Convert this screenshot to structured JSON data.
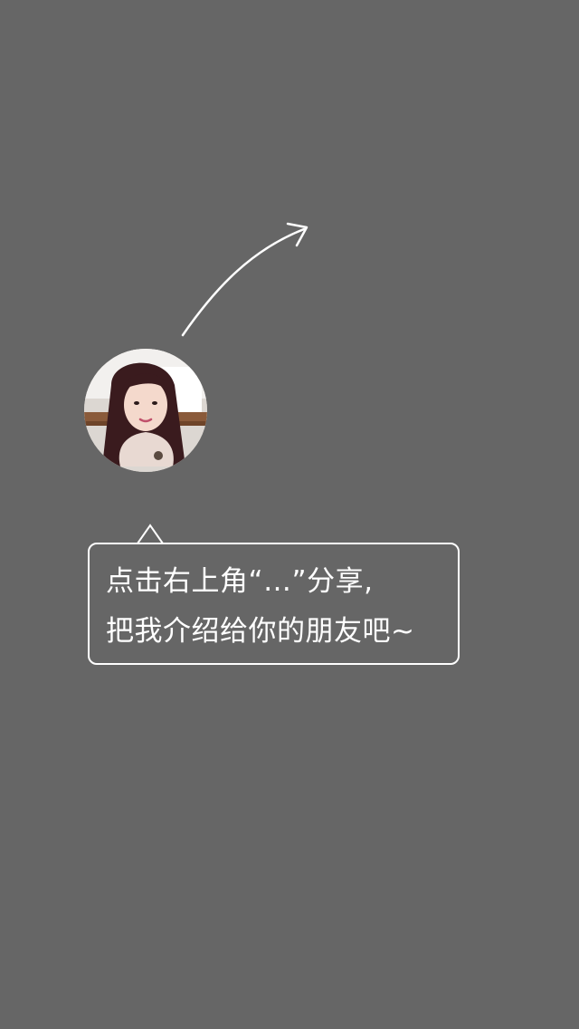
{
  "guide": {
    "line1": "点击右上角“…”分享,",
    "line2": "把我介绍给你的朋友吧~"
  },
  "icons": {
    "arrow": "curved-arrow-icon",
    "avatar": "profile-photo"
  },
  "colors": {
    "overlay": "#666666",
    "stroke": "#ffffff",
    "text": "#ffffff"
  }
}
